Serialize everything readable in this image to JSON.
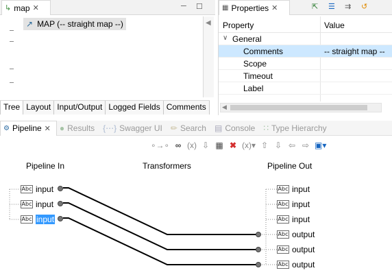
{
  "map_panel": {
    "tab_title": "map",
    "tree_item": "MAP (-- straight map --)",
    "bottom_tabs": [
      "Tree",
      "Layout",
      "Input/Output",
      "Logged Fields",
      "Comments"
    ]
  },
  "properties": {
    "tab_title": "Properties",
    "col_property": "Property",
    "col_value": "Value",
    "group": "General",
    "rows": [
      {
        "name": "Comments",
        "value": "-- straight map --"
      },
      {
        "name": "Scope",
        "value": ""
      },
      {
        "name": "Timeout",
        "value": ""
      },
      {
        "name": "Label",
        "value": ""
      }
    ]
  },
  "views": {
    "tabs": [
      "Pipeline",
      "Results",
      "Swagger UI",
      "Search",
      "Console",
      "Type Hierarchy"
    ],
    "active": "Pipeline"
  },
  "pipeline": {
    "header_in": "Pipeline In",
    "header_transformers": "Transformers",
    "header_out": "Pipeline Out",
    "inputs": [
      "input",
      "input",
      "input"
    ],
    "outputs": [
      "input",
      "input",
      "input",
      "output",
      "output",
      "output"
    ],
    "selected_input_index": 2
  },
  "icons": {
    "map_tab": "map-service-icon",
    "tree_item": "map-step-icon",
    "field": "string-field-icon"
  },
  "colors": {
    "selection": "#3399ff",
    "row_selected": "#cde8ff",
    "connector": "#000000"
  }
}
